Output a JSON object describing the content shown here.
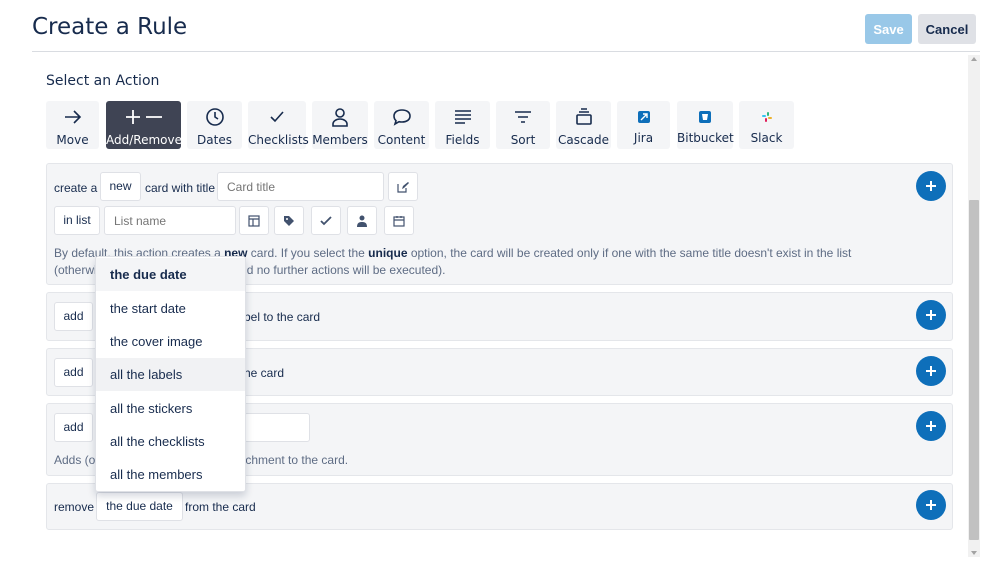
{
  "header": {
    "title": "Create a Rule",
    "save_label": "Save",
    "cancel_label": "Cancel"
  },
  "section": {
    "title": "Select an Action"
  },
  "actions": [
    {
      "label": "Move",
      "icon": "arrow-right-icon"
    },
    {
      "label": "Add/Remove",
      "icon": "plus-minus-icon",
      "active": true
    },
    {
      "label": "Dates",
      "icon": "clock-icon"
    },
    {
      "label": "Checklists",
      "icon": "check-icon"
    },
    {
      "label": "Members",
      "icon": "person-icon"
    },
    {
      "label": "Content",
      "icon": "speech-bubble-icon"
    },
    {
      "label": "Fields",
      "icon": "lines-icon"
    },
    {
      "label": "Sort",
      "icon": "sort-icon"
    },
    {
      "label": "Cascade",
      "icon": "cascade-icon"
    },
    {
      "label": "Jira",
      "icon": "jira-icon"
    },
    {
      "label": "Bitbucket",
      "icon": "bitbucket-icon"
    },
    {
      "label": "Slack",
      "icon": "slack-icon"
    }
  ],
  "card1": {
    "create_a": "create a",
    "new_value": "new",
    "card_with_title": "card with title",
    "title_placeholder": "Card title",
    "in_list_value": "in list",
    "list_placeholder": "List name",
    "note_line1_a": "By default, this action creates a ",
    "note_line1_b": "new",
    "note_line1_c": " card. If you select the ",
    "note_line1_d": "unique",
    "note_line1_e": " option, the card will be created only if one with the same title doesn't exist in the list",
    "note_line2_a": "(otherwi",
    "note_line2_b": "d no further actions will be executed)."
  },
  "card2": {
    "add_value": "add",
    "tail": "bel to the card"
  },
  "card3": {
    "add_value": "add",
    "tail": "he card"
  },
  "card4": {
    "add_value": "add",
    "note_a": "Adds (o",
    "note_b": "chment to the card."
  },
  "card5": {
    "remove": "remove",
    "value": "the due date",
    "tail": "from the card"
  },
  "dropdown": {
    "items": [
      "the due date",
      "the start date",
      "the cover image",
      "all the labels",
      "all the stickers",
      "all the checklists",
      "all the members"
    ],
    "selected": "the due date",
    "hovered": "all the labels"
  },
  "colors": {
    "accent": "#0e6fba",
    "active_action": "#3f4454",
    "save_disabled": "#99c8e8"
  }
}
